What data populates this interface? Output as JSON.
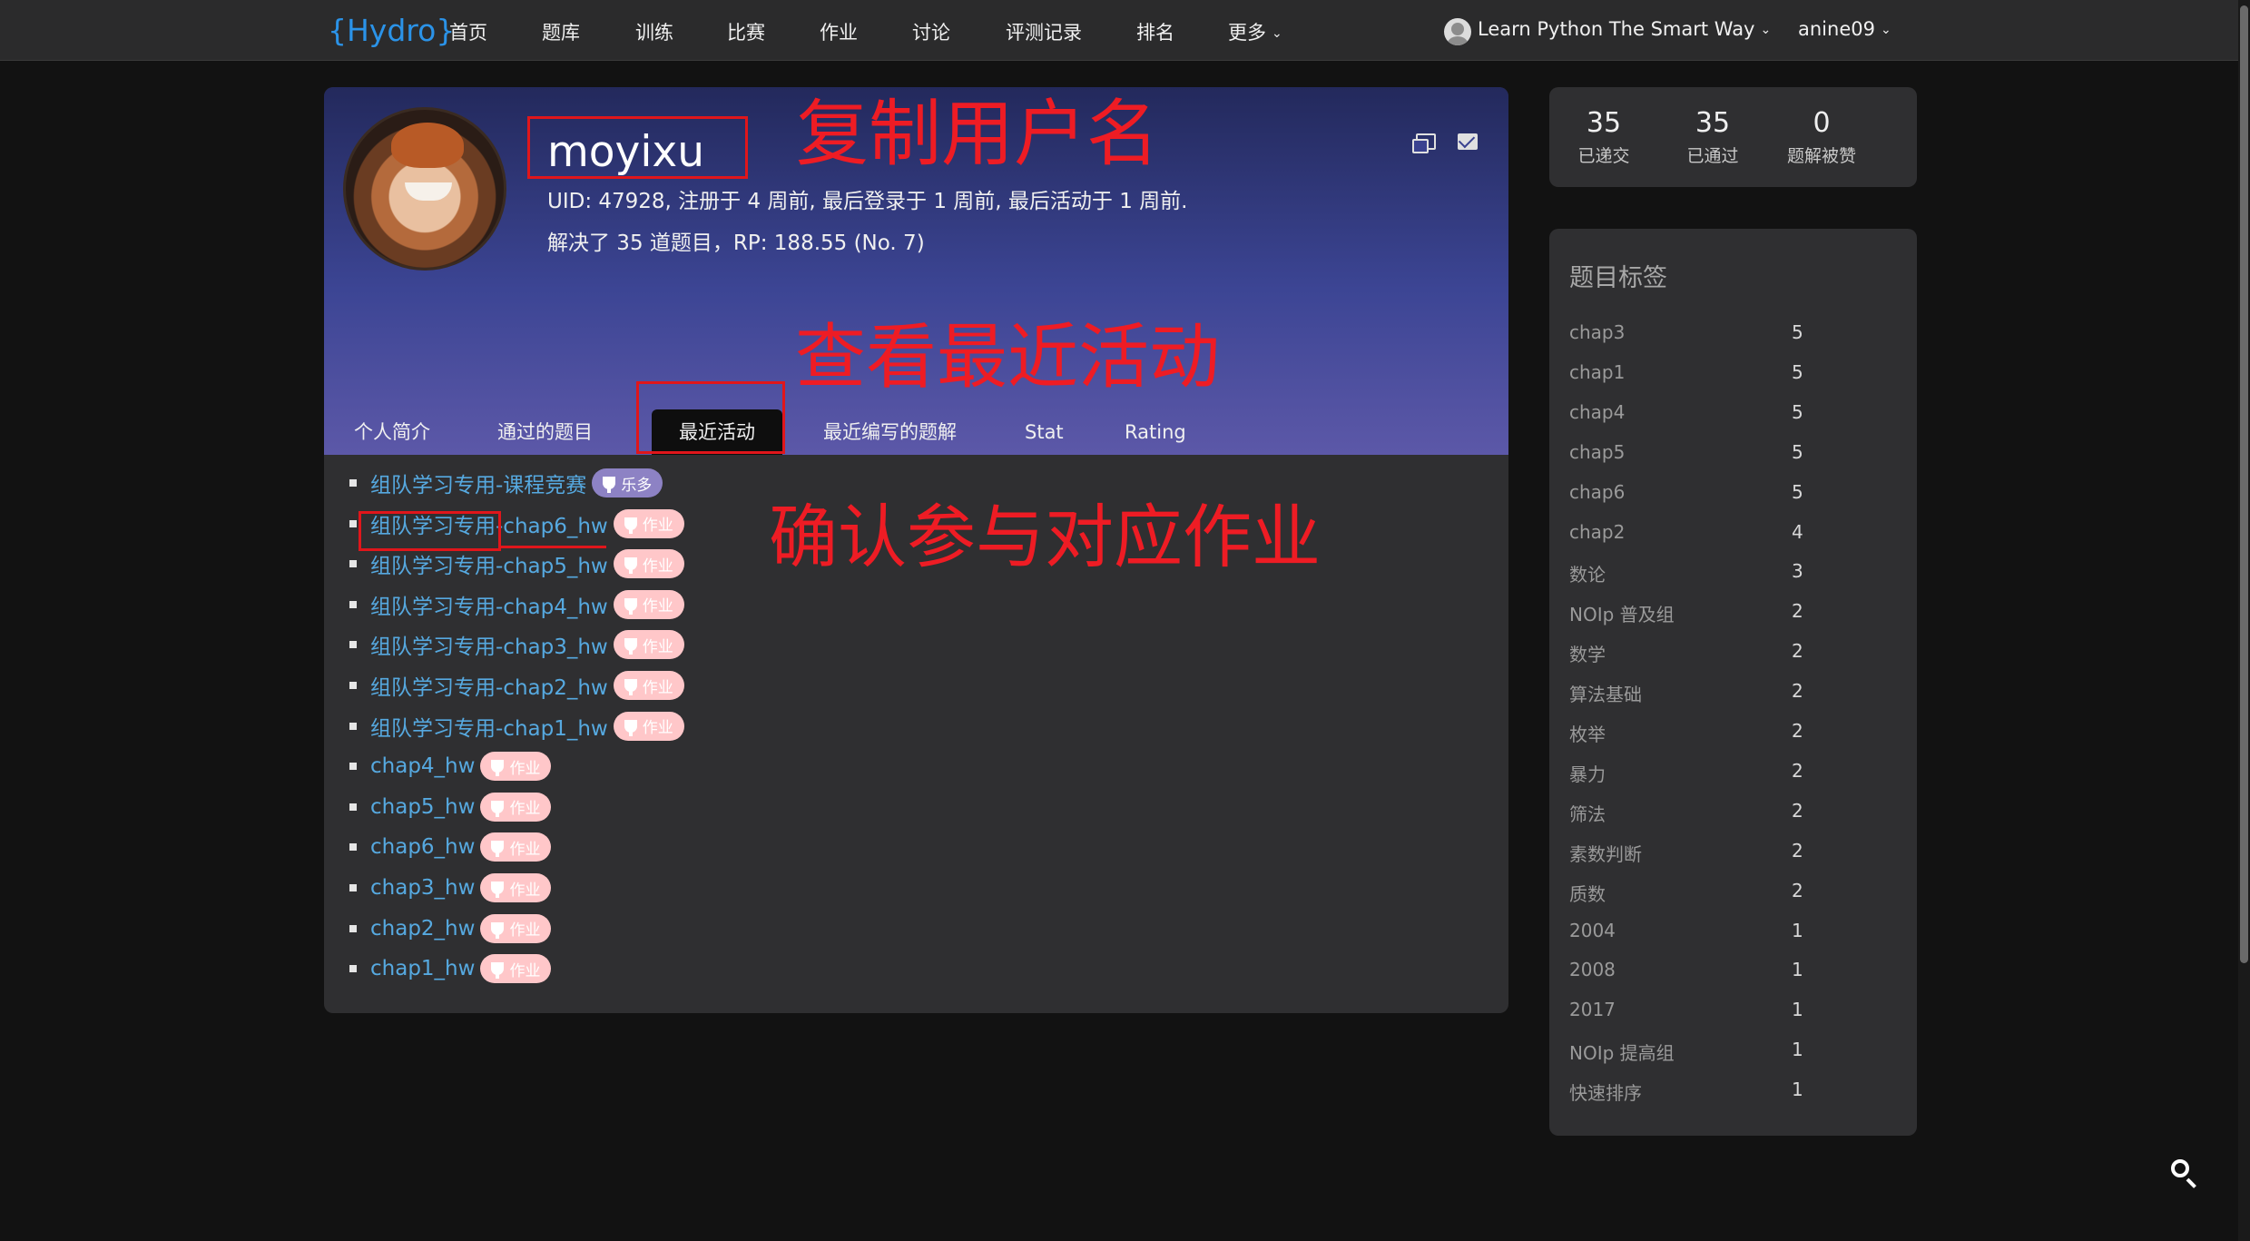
{
  "nav": {
    "logo": "{Hydro}",
    "items": [
      "首页",
      "题库",
      "训练",
      "比赛",
      "作业",
      "讨论",
      "评测记录",
      "排名",
      "更多"
    ],
    "domain": "Learn Python The Smart Way",
    "user": "anine09"
  },
  "profile": {
    "username": "moyixu",
    "meta": "UID: 47928, 注册于 4 周前, 最后登录于 1 周前, 最后活动于 1 周前.",
    "meta2": "解决了 35 道题目，RP: 188.55 (No. 7)",
    "tabs": [
      "个人简介",
      "通过的题目",
      "最近活动",
      "最近编写的题解",
      "Stat",
      "Rating"
    ],
    "active_tab": "最近活动"
  },
  "activities": [
    {
      "title": "组队学习专用-课程竞赛",
      "badge": "乐多",
      "type": "contest"
    },
    {
      "title": "组队学习专用-chap6_hw",
      "badge": "作业",
      "type": "hw"
    },
    {
      "title": "组队学习专用-chap5_hw",
      "badge": "作业",
      "type": "hw"
    },
    {
      "title": "组队学习专用-chap4_hw",
      "badge": "作业",
      "type": "hw"
    },
    {
      "title": "组队学习专用-chap3_hw",
      "badge": "作业",
      "type": "hw"
    },
    {
      "title": "组队学习专用-chap2_hw",
      "badge": "作业",
      "type": "hw"
    },
    {
      "title": "组队学习专用-chap1_hw",
      "badge": "作业",
      "type": "hw"
    },
    {
      "title": "chap4_hw",
      "badge": "作业",
      "type": "hw"
    },
    {
      "title": "chap5_hw",
      "badge": "作业",
      "type": "hw"
    },
    {
      "title": "chap6_hw",
      "badge": "作业",
      "type": "hw"
    },
    {
      "title": "chap3_hw",
      "badge": "作业",
      "type": "hw"
    },
    {
      "title": "chap2_hw",
      "badge": "作业",
      "type": "hw"
    },
    {
      "title": "chap1_hw",
      "badge": "作业",
      "type": "hw"
    }
  ],
  "stats": [
    {
      "value": "35",
      "label": "已递交"
    },
    {
      "value": "35",
      "label": "已通过"
    },
    {
      "value": "0",
      "label": "题解被赞"
    }
  ],
  "tags": {
    "title": "题目标签",
    "items": [
      {
        "name": "chap3",
        "count": "5"
      },
      {
        "name": "chap1",
        "count": "5"
      },
      {
        "name": "chap4",
        "count": "5"
      },
      {
        "name": "chap5",
        "count": "5"
      },
      {
        "name": "chap6",
        "count": "5"
      },
      {
        "name": "chap2",
        "count": "4"
      },
      {
        "name": "数论",
        "count": "3"
      },
      {
        "name": "NOIp 普及组",
        "count": "2"
      },
      {
        "name": "数学",
        "count": "2"
      },
      {
        "name": "算法基础",
        "count": "2"
      },
      {
        "name": "枚举",
        "count": "2"
      },
      {
        "name": "暴力",
        "count": "2"
      },
      {
        "name": "筛法",
        "count": "2"
      },
      {
        "name": "素数判断",
        "count": "2"
      },
      {
        "name": "质数",
        "count": "2"
      },
      {
        "name": "2004",
        "count": "1"
      },
      {
        "name": "2008",
        "count": "1"
      },
      {
        "name": "2017",
        "count": "1"
      },
      {
        "name": "NOIp 提高组",
        "count": "1"
      },
      {
        "name": "快速排序",
        "count": "1"
      }
    ]
  },
  "annotations": {
    "copy_username": "复制用户名",
    "view_activity": "查看最近活动",
    "confirm_hw": "确认参与对应作业",
    "color": "#e0161b"
  }
}
